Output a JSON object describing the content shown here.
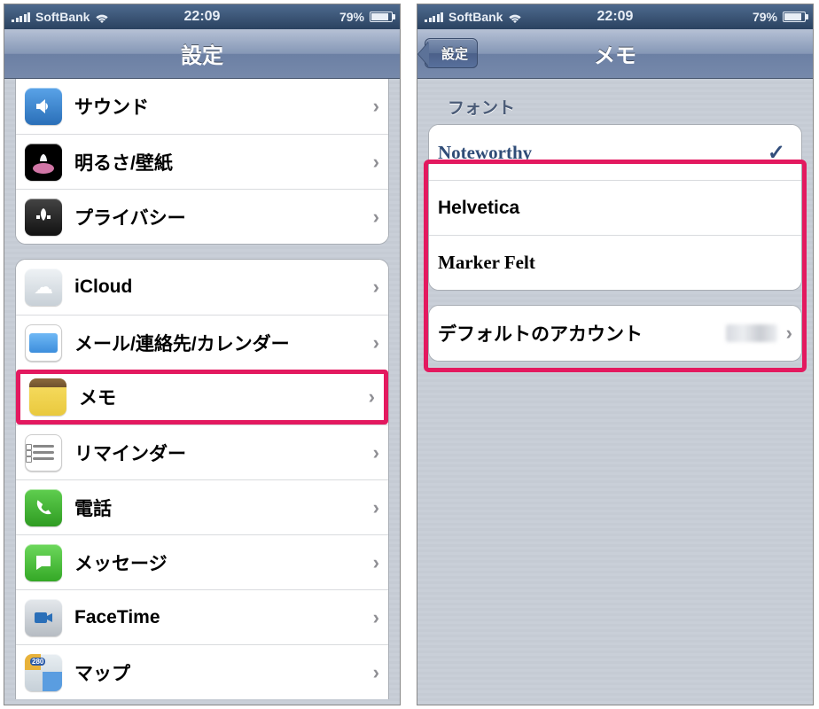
{
  "status": {
    "carrier": "SoftBank",
    "time": "22:09",
    "battery_pct": "79%"
  },
  "left": {
    "title": "設定",
    "group1": {
      "sound": "サウンド",
      "brightness": "明るさ/壁紙",
      "privacy": "プライバシー"
    },
    "group2": {
      "icloud": "iCloud",
      "mail": "メール/連絡先/カレンダー",
      "notes": "メモ",
      "reminders": "リマインダー",
      "phone": "電話",
      "messages": "メッセージ",
      "facetime": "FaceTime",
      "maps": "マップ"
    }
  },
  "right": {
    "back": "設定",
    "title": "メモ",
    "font_header": "フォント",
    "fonts": {
      "noteworthy": "Noteworthy",
      "helvetica": "Helvetica",
      "markerfelt": "Marker Felt"
    },
    "default_account": "デフォルトのアカウント"
  }
}
